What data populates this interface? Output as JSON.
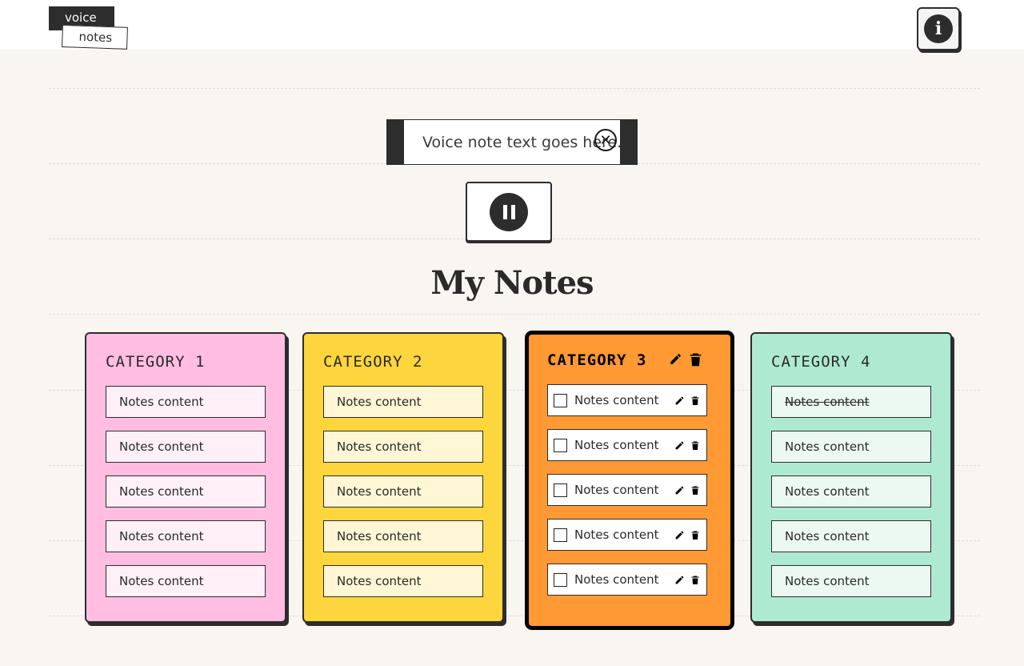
{
  "logo": {
    "line1": "voice",
    "line2": "notes"
  },
  "header": {
    "info_icon": "info-icon",
    "info_glyph": "i"
  },
  "voice_input": {
    "text": "Voice note text goes here.",
    "close_icon": "close-circle-icon"
  },
  "recorder": {
    "state": "recording",
    "button_icon": "pause-icon"
  },
  "page_title": "My Notes",
  "colors": {
    "background": "#f9f5f0",
    "dark": "#2d2d2d",
    "category_1": "#ffbde2",
    "category_2": "#fdd53c",
    "category_3": "#ff9933",
    "category_4": "#aeead2"
  },
  "categories": [
    {
      "title": "CATEGORY 1",
      "color": "#ffbde2",
      "note_bg": "#fff0f7",
      "notes": [
        "Notes content",
        "Notes content",
        "Notes content",
        "Notes content",
        "Notes content"
      ]
    },
    {
      "title": "CATEGORY 2",
      "color": "#fdd53c",
      "note_bg": "#fef6d4",
      "notes": [
        "Notes content",
        "Notes content",
        "Notes content",
        "Notes content",
        "Notes content"
      ]
    },
    {
      "title": "CATEGORY 3",
      "color": "#ff9933",
      "note_bg": "#ffffff",
      "selected": true,
      "notes": [
        "Notes content",
        "Notes content",
        "Notes content",
        "Notes content",
        "Notes content"
      ]
    },
    {
      "title": "CATEGORY 4",
      "color": "#aeead2",
      "note_bg": "#ecf9f3",
      "notes": [
        "Notes content",
        "Notes content",
        "Notes content",
        "Notes content",
        "Notes content"
      ],
      "done_notes": [
        0
      ]
    }
  ]
}
